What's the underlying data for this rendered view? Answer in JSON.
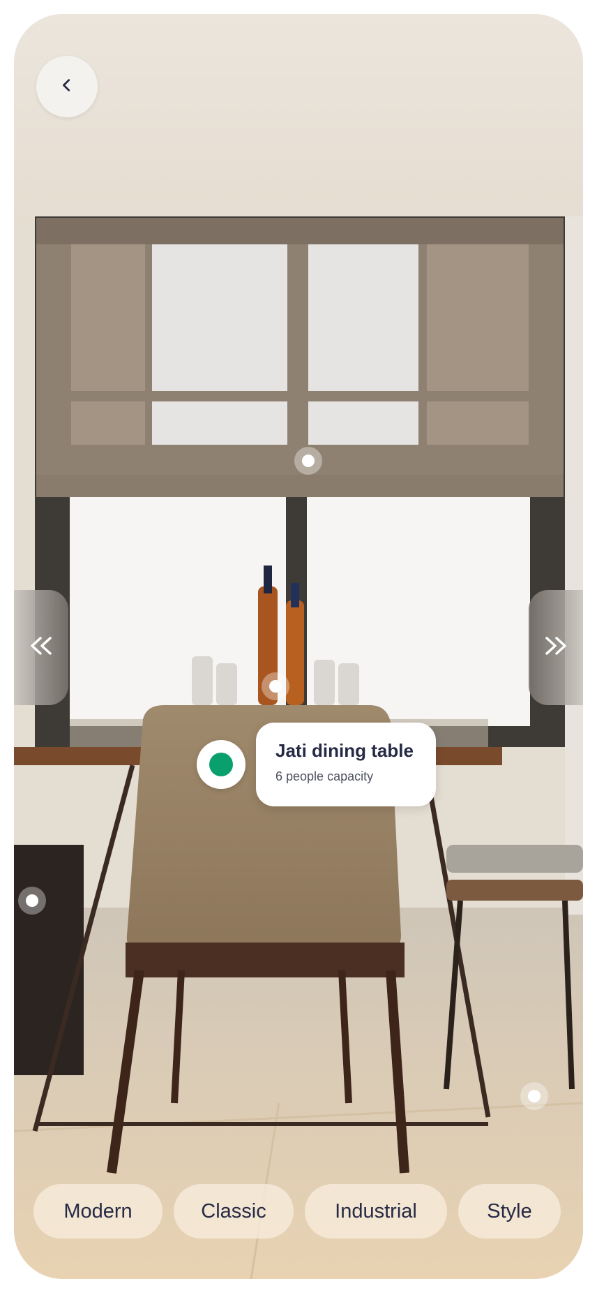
{
  "product_card": {
    "title": "Jati dining table",
    "subtitle": "6 people capacity"
  },
  "style_filters": [
    {
      "label": "Modern"
    },
    {
      "label": "Classic"
    },
    {
      "label": "Industrial"
    },
    {
      "label": "Style"
    }
  ],
  "icons": {
    "back": "chevron-left-icon",
    "prev": "double-chevron-left-icon",
    "next": "double-chevron-right-icon"
  },
  "colors": {
    "accent": "#0aa06e",
    "text_primary": "#262a45",
    "pill_bg": "#f6eada"
  }
}
